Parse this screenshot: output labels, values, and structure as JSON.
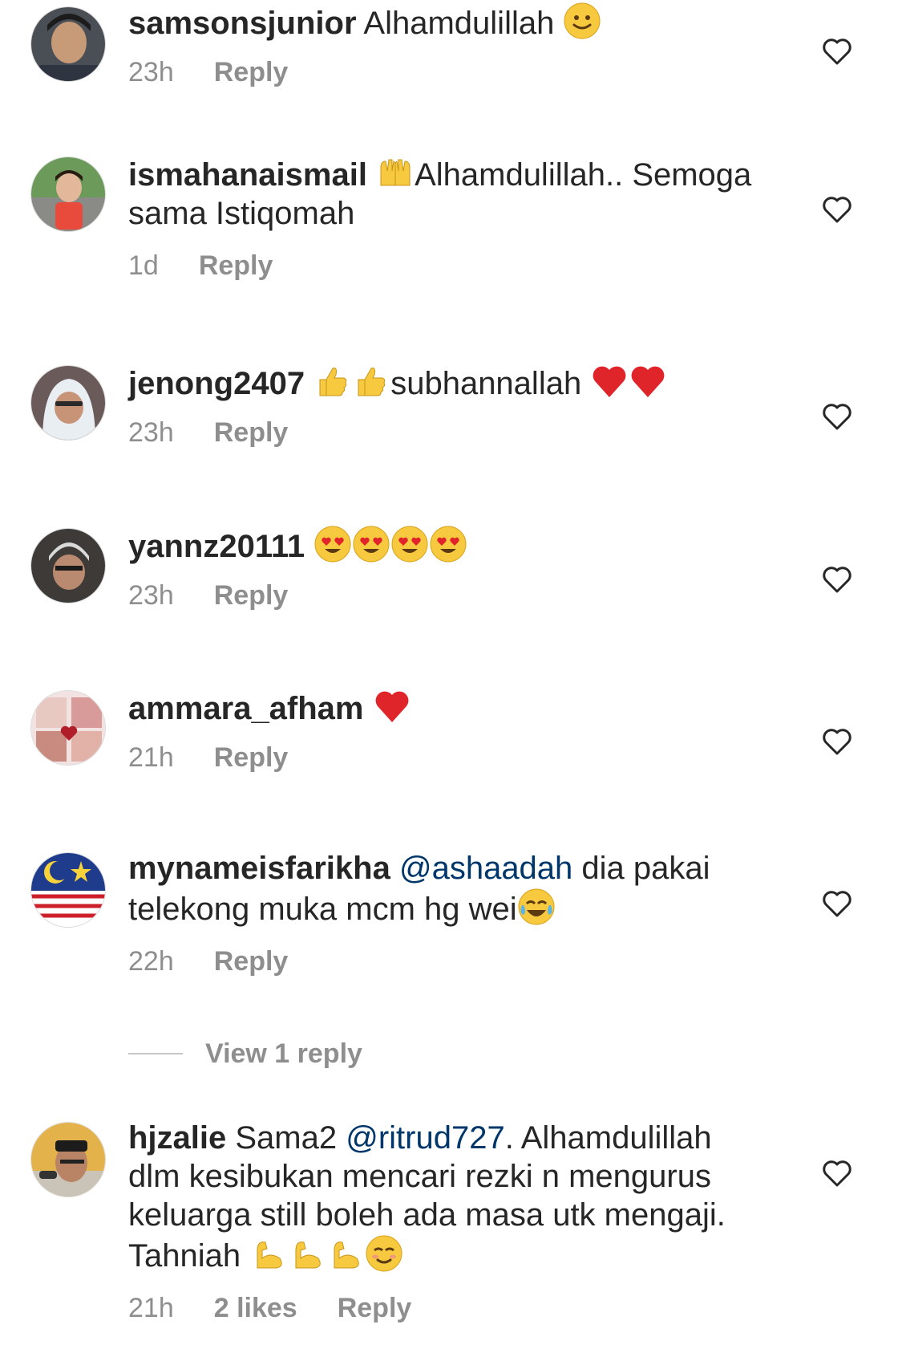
{
  "comments": [
    {
      "username": "samsonsjunior",
      "text_before": " Alhamdulillah ",
      "time": "23h",
      "reply": "Reply"
    },
    {
      "username": "ismahanaismail",
      "text_before": " ",
      "text_after": "Alhamdulillah.. Semoga sama Istiqomah",
      "time": "1d",
      "reply": "Reply"
    },
    {
      "username": "jenong2407",
      "text_before": " ",
      "text_after": "subhannallah ",
      "time": "23h",
      "reply": "Reply"
    },
    {
      "username": "yannz20111",
      "text_before": " ",
      "time": "23h",
      "reply": "Reply"
    },
    {
      "username": "ammara_afham",
      "text_before": " ",
      "time": "21h",
      "reply": "Reply"
    },
    {
      "username": "mynameisfarikha",
      "text_before": " ",
      "mention": "@ashaadah",
      "text_after": " dia pakai telekong muka mcm hg wei",
      "time": "22h",
      "reply": "Reply"
    },
    {
      "username": "hjzalie",
      "text_before": " Sama2 ",
      "mention": "@ritrud727",
      "text_after": ". Alhamdulillah dlm kesibukan mencari rezki n mengurus keluarga still boleh ada masa utk mengaji. Tahniah ",
      "time": "21h",
      "likes": "2 likes",
      "reply": "Reply"
    }
  ],
  "view_replies": "View 1 reply",
  "icons": {
    "heart": "heart-outline-icon"
  },
  "colors": {
    "text": "#262626",
    "secondary": "#8e8e8e",
    "mention": "#00376b",
    "divider": "#c7c7c7"
  }
}
